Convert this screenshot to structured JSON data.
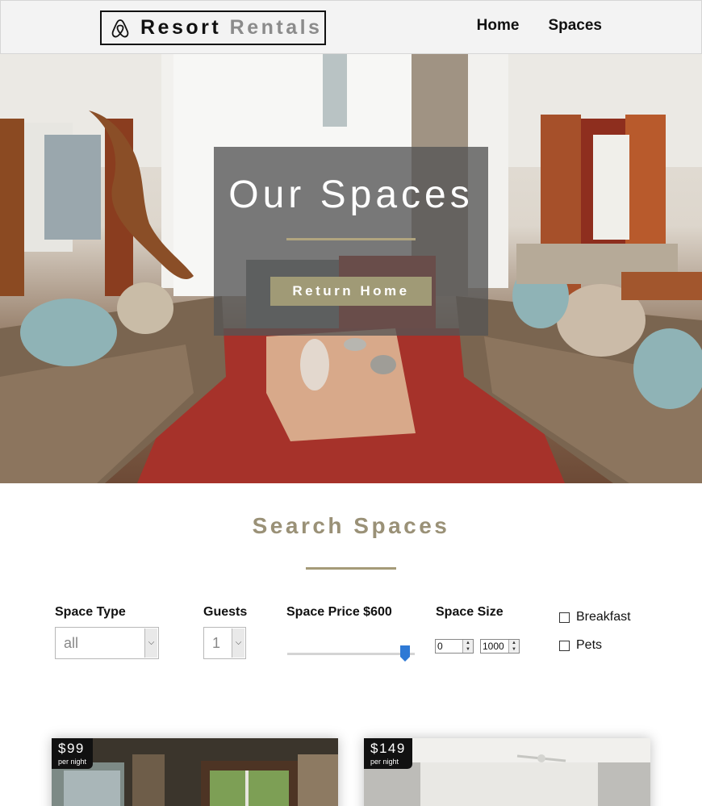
{
  "header": {
    "logo_primary": "Resort",
    "logo_secondary": "Rentals",
    "logo_icon": "airbnb-icon",
    "nav": [
      {
        "label": "Home"
      },
      {
        "label": "Spaces"
      }
    ]
  },
  "hero": {
    "title": "Our Spaces",
    "button_label": "Return Home",
    "image_subject": "living-room-photo"
  },
  "search": {
    "title": "Search Spaces",
    "space_type": {
      "label": "Space Type",
      "value": "all"
    },
    "guests": {
      "label": "Guests",
      "value": "1"
    },
    "price": {
      "label": "Space Price $600",
      "value": 600
    },
    "size": {
      "label": "Space Size",
      "min": "0",
      "max": "1000"
    },
    "checkboxes": [
      {
        "label": "Breakfast",
        "checked": false
      },
      {
        "label": "Pets",
        "checked": false
      }
    ]
  },
  "cards": [
    {
      "price": "$99",
      "per": "per night"
    },
    {
      "price": "$149",
      "per": "per night"
    }
  ],
  "colors": {
    "accent": "#9a9177",
    "button": "#a09a76",
    "slider": "#2e79d5"
  }
}
